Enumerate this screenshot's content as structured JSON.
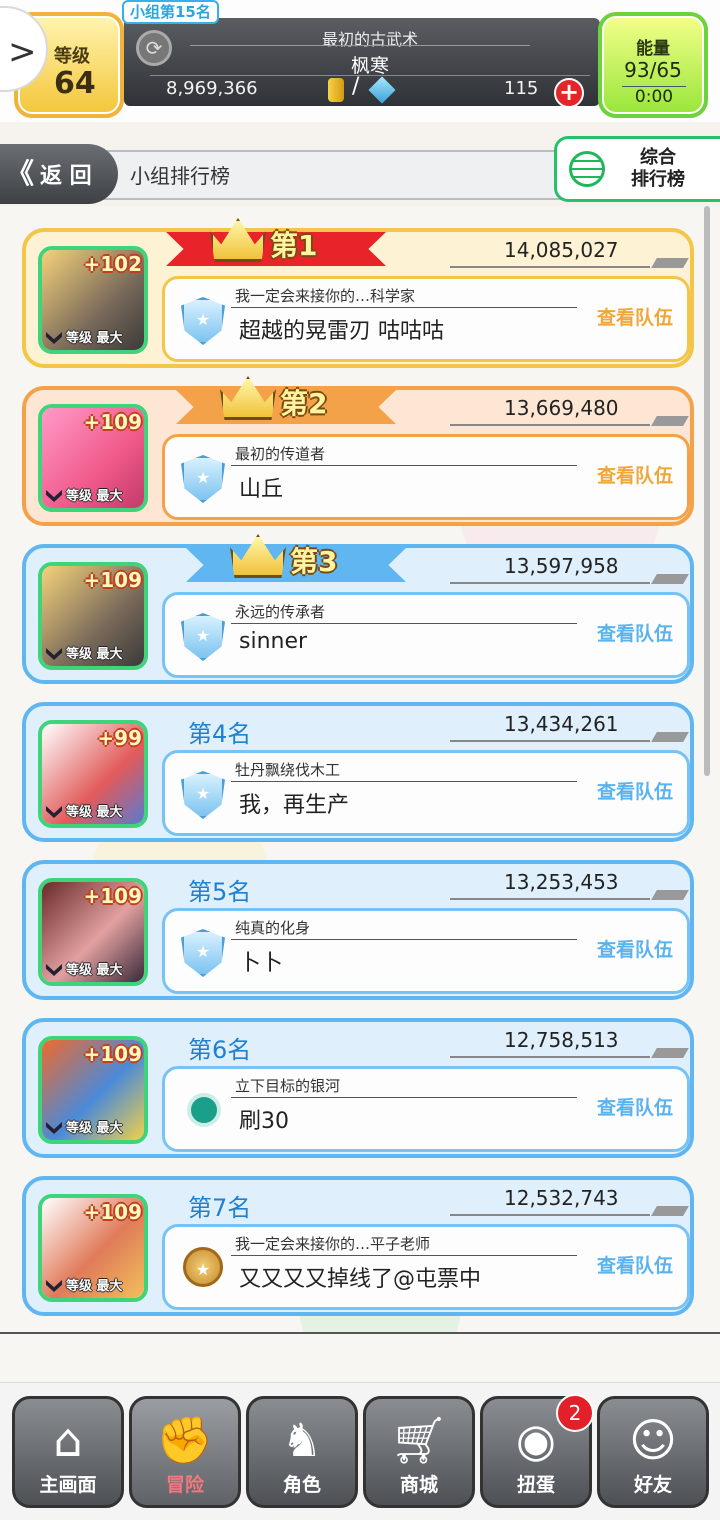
{
  "header": {
    "group_rank_badge": "小组第15名",
    "level_label": "等级",
    "level_value": "64",
    "player_title": "最初的古武术",
    "player_name": "枫寒",
    "gold": "8,969,366",
    "currency_separator": "/",
    "gems": "115",
    "plus_symbol": "+",
    "energy_label": "能量",
    "energy_value": "93/65",
    "energy_timer": "0:00"
  },
  "title_strip": {
    "back_label": "返 回",
    "back_arrows": "《",
    "title": "小组排行榜",
    "overall_ranking_label": "综合\n排行榜"
  },
  "ranking": [
    {
      "rank_label": "第1",
      "score": "14,085,027",
      "team_title": "我一定会来接你的…科学家",
      "name": "超越的晃雷刃 咕咕咕",
      "bonus": "+102",
      "level_tag": "等级 最大",
      "view_label": "查看队伍",
      "style": "gold",
      "badge": "shield"
    },
    {
      "rank_label": "第2",
      "score": "13,669,480",
      "team_title": "最初的传道者",
      "name": "山丘",
      "bonus": "+109",
      "level_tag": "等级 最大",
      "view_label": "查看队伍",
      "style": "orange",
      "badge": "shield"
    },
    {
      "rank_label": "第3",
      "score": "13,597,958",
      "team_title": "永远的传承者",
      "name": "sinner",
      "bonus": "+109",
      "level_tag": "等级 最大",
      "view_label": "查看队伍",
      "style": "blue",
      "badge": "shield"
    },
    {
      "rank_label": "第4名",
      "score": "13,434,261",
      "team_title": "牡丹飘绕伐木工",
      "name": "我，再生产",
      "bonus": "+99",
      "level_tag": "等级 最大",
      "view_label": "查看队伍",
      "style": "blue",
      "badge": "shield"
    },
    {
      "rank_label": "第5名",
      "score": "13,253,453",
      "team_title": "纯真的化身",
      "name": "卜卜",
      "bonus": "+109",
      "level_tag": "等级 最大",
      "view_label": "查看队伍",
      "style": "blue",
      "badge": "shield"
    },
    {
      "rank_label": "第6名",
      "score": "12,758,513",
      "team_title": "立下目标的银河",
      "name": "刷30",
      "bonus": "+109",
      "level_tag": "等级 最大",
      "view_label": "查看队伍",
      "style": "blue",
      "badge": "circle"
    },
    {
      "rank_label": "第7名",
      "score": "12,532,743",
      "team_title": "我一定会来接你的…平子老师",
      "name": "又又又又掉线了@屯票中",
      "bonus": "+109",
      "level_tag": "等级 最大",
      "view_label": "查看队伍",
      "style": "blue",
      "badge": "coin"
    }
  ],
  "bottom_nav": {
    "items": [
      {
        "label": "主画面",
        "icon": "home-icon"
      },
      {
        "label": "冒险",
        "icon": "handshake-icon"
      },
      {
        "label": "角色",
        "icon": "rabbit-icon"
      },
      {
        "label": "商城",
        "icon": "cart-icon"
      },
      {
        "label": "扭蛋",
        "icon": "egg-icon"
      },
      {
        "label": "好友",
        "icon": "friends-icon"
      }
    ],
    "active_index": 1,
    "gacha_notification": "2"
  },
  "colors": {
    "gold_row": "#f3c64a",
    "orange_row": "#f3a24a",
    "blue_row": "#60b6f0",
    "rank_text": "#1f7fd0",
    "avatar_frame": "#3fd47a",
    "notif_red": "#e2202a"
  }
}
